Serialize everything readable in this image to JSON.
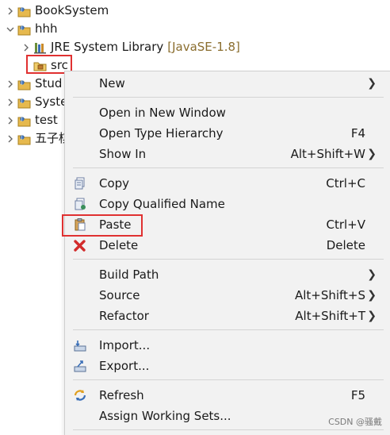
{
  "tree": {
    "items": [
      {
        "label": "BookSystem",
        "expanded": false
      },
      {
        "label": "hhh",
        "expanded": true
      },
      {
        "label": "JRE System Library",
        "decoration": "[JavaSE-1.8]"
      },
      {
        "label": "src"
      },
      {
        "label": "Stud"
      },
      {
        "label": "Syste"
      },
      {
        "label": "test"
      },
      {
        "label": "五子棋"
      }
    ]
  },
  "context_menu": {
    "new": {
      "label": "New"
    },
    "open_window": {
      "label": "Open in New Window"
    },
    "open_type": {
      "label": "Open Type Hierarchy",
      "shortcut": "F4"
    },
    "show_in": {
      "label": "Show In",
      "shortcut": "Alt+Shift+W"
    },
    "copy": {
      "label": "Copy",
      "shortcut": "Ctrl+C"
    },
    "copy_qualified": {
      "label": "Copy Qualified Name"
    },
    "paste": {
      "label": "Paste",
      "shortcut": "Ctrl+V"
    },
    "delete": {
      "label": "Delete",
      "shortcut": "Delete"
    },
    "build_path": {
      "label": "Build Path"
    },
    "source": {
      "label": "Source",
      "shortcut": "Alt+Shift+S"
    },
    "refactor": {
      "label": "Refactor",
      "shortcut": "Alt+Shift+T"
    },
    "import": {
      "label": "Import..."
    },
    "export": {
      "label": "Export..."
    },
    "refresh": {
      "label": "Refresh",
      "shortcut": "F5"
    },
    "assign_sets": {
      "label": "Assign Working Sets..."
    }
  },
  "icons": {
    "chevron_right": "chevron-right-icon",
    "chevron_down": "chevron-down-icon",
    "project": "java-project-icon",
    "library": "library-icon",
    "package": "source-folder-icon",
    "copy": "copy-icon",
    "copy_qualified": "copy-qualified-icon",
    "paste": "paste-icon",
    "delete": "delete-icon",
    "import": "import-icon",
    "export": "export-icon",
    "refresh": "refresh-icon"
  },
  "colors": {
    "highlight": "#e03131",
    "menu_bg": "#f2f2f2",
    "decoration": "#8a6d2e"
  },
  "watermark": "CSDN @骚戴"
}
